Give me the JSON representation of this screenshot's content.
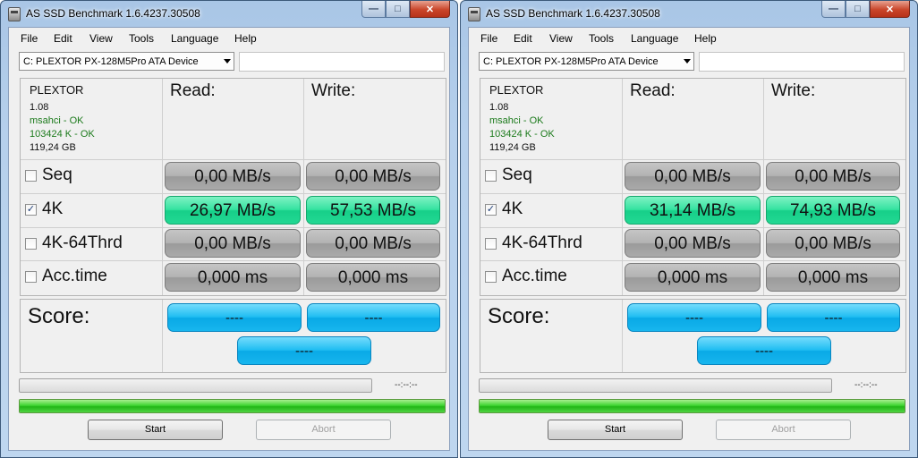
{
  "windows": [
    {
      "title": "AS SSD Benchmark 1.6.4237.30508",
      "menu": [
        "File",
        "Edit",
        "View",
        "Tools",
        "Language",
        "Help"
      ],
      "drive": "C: PLEXTOR PX-128M5Pro ATA Device",
      "info": {
        "brand": "PLEXTOR",
        "firmware": "1.08",
        "driver": "msahci - OK",
        "alignment": "103424 K - OK",
        "size": "119,24 GB"
      },
      "read_header": "Read:",
      "write_header": "Write:",
      "rows": [
        {
          "label": "Seq",
          "checked": false,
          "read": "0,00 MB/s",
          "write": "0,00 MB/s"
        },
        {
          "label": "4K",
          "checked": true,
          "read": "26,97 MB/s",
          "write": "57,53 MB/s"
        },
        {
          "label": "4K-64Thrd",
          "checked": false,
          "read": "0,00 MB/s",
          "write": "0,00 MB/s"
        },
        {
          "label": "Acc.time",
          "checked": false,
          "read": "0,000 ms",
          "write": "0,000 ms"
        }
      ],
      "score_label": "Score:",
      "score_read": "----",
      "score_write": "----",
      "score_total": "----",
      "time_text": "--:--:--",
      "progress_complete": 1.0,
      "start_label": "Start",
      "abort_label": "Abort"
    },
    {
      "title": "AS SSD Benchmark 1.6.4237.30508",
      "menu": [
        "File",
        "Edit",
        "View",
        "Tools",
        "Language",
        "Help"
      ],
      "drive": "C: PLEXTOR PX-128M5Pro ATA Device",
      "info": {
        "brand": "PLEXTOR",
        "firmware": "1.08",
        "driver": "msahci - OK",
        "alignment": "103424 K - OK",
        "size": "119,24 GB"
      },
      "read_header": "Read:",
      "write_header": "Write:",
      "rows": [
        {
          "label": "Seq",
          "checked": false,
          "read": "0,00 MB/s",
          "write": "0,00 MB/s"
        },
        {
          "label": "4K",
          "checked": true,
          "read": "31,14 MB/s",
          "write": "74,93 MB/s"
        },
        {
          "label": "4K-64Thrd",
          "checked": false,
          "read": "0,00 MB/s",
          "write": "0,00 MB/s"
        },
        {
          "label": "Acc.time",
          "checked": false,
          "read": "0,000 ms",
          "write": "0,000 ms"
        }
      ],
      "score_label": "Score:",
      "score_read": "----",
      "score_write": "----",
      "score_total": "----",
      "time_text": "--:--:--",
      "progress_complete": 1.0,
      "start_label": "Start",
      "abort_label": "Abort"
    }
  ],
  "icons": {
    "app": "disk-icon",
    "minimize": "minimize-icon",
    "maximize": "maximize-icon",
    "close": "close-icon",
    "dropdown": "chevron-down-icon",
    "checkbox": "checkmark-icon"
  },
  "colors": {
    "result_active": "#22d893",
    "result_idle": "#a9a9a9",
    "score": "#17b6ee",
    "progress_fill": "#3fd432"
  }
}
